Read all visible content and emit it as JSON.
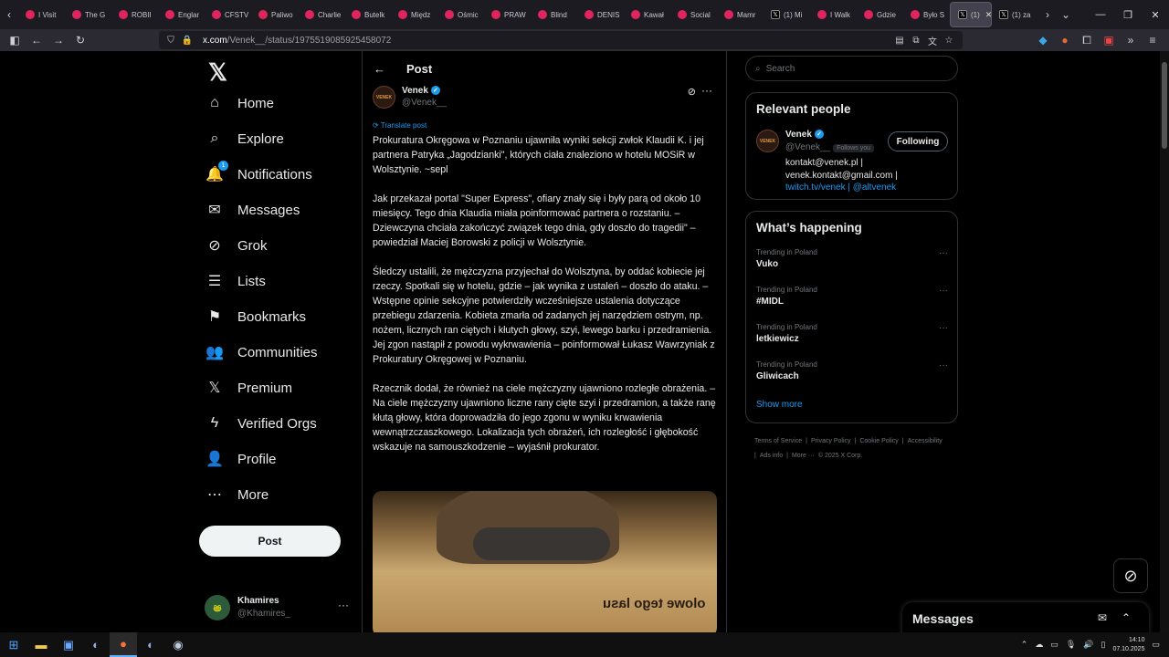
{
  "browser": {
    "tabs": [
      {
        "label": "I Visit",
        "icon": "yt-favicon"
      },
      {
        "label": "The G",
        "icon": "yt-favicon"
      },
      {
        "label": "ROBII",
        "icon": "yt-favicon"
      },
      {
        "label": "Englar",
        "icon": "yt-favicon"
      },
      {
        "label": "CFSTV",
        "icon": "yt-favicon"
      },
      {
        "label": "Paliwo",
        "icon": "yt-favicon"
      },
      {
        "label": "Charlie",
        "icon": "yt-favicon"
      },
      {
        "label": "Butelk",
        "icon": "yt-favicon"
      },
      {
        "label": "Międz",
        "icon": "yt-favicon"
      },
      {
        "label": "Ośmic",
        "icon": "yt-favicon"
      },
      {
        "label": "PRAW",
        "icon": "yt-favicon"
      },
      {
        "label": "Blind",
        "icon": "yt-favicon"
      },
      {
        "label": "DENIS",
        "icon": "yt-favicon"
      },
      {
        "label": "Kawał",
        "icon": "yt-favicon"
      },
      {
        "label": "Social",
        "icon": "yt-favicon"
      },
      {
        "label": "Mamr",
        "icon": "yt-favicon"
      },
      {
        "label": "(1) Mi",
        "icon": "x-favicon"
      },
      {
        "label": "I Walk",
        "icon": "yt-favicon"
      },
      {
        "label": "Gdzie",
        "icon": "yt-favicon"
      },
      {
        "label": "Było S",
        "icon": "yt-favicon"
      }
    ],
    "active_tab": {
      "label": "(1)",
      "icon": "x-favicon"
    },
    "after_tab": {
      "label": "(1) za",
      "icon": "x-favicon"
    },
    "url_domain": "x.com",
    "url_path": "/Venek__/status/1975519085925458072"
  },
  "nav": {
    "items": [
      {
        "label": "Home",
        "icon": "home-icon",
        "glyph": "⌂"
      },
      {
        "label": "Explore",
        "icon": "search-icon",
        "glyph": "⌕"
      },
      {
        "label": "Notifications",
        "icon": "bell-icon",
        "glyph": "🔔"
      },
      {
        "label": "Messages",
        "icon": "mail-icon",
        "glyph": "✉"
      },
      {
        "label": "Grok",
        "icon": "grok-icon",
        "glyph": "⊘"
      },
      {
        "label": "Lists",
        "icon": "list-icon",
        "glyph": "☰"
      },
      {
        "label": "Bookmarks",
        "icon": "bookmark-icon",
        "glyph": "⚑"
      },
      {
        "label": "Communities",
        "icon": "communities-icon",
        "glyph": "👥"
      },
      {
        "label": "Premium",
        "icon": "x-premium-icon",
        "glyph": "𝕏"
      },
      {
        "label": "Verified Orgs",
        "icon": "lightning-icon",
        "glyph": "ϟ"
      },
      {
        "label": "Profile",
        "icon": "person-icon",
        "glyph": "👤"
      },
      {
        "label": "More",
        "icon": "more-circle-icon",
        "glyph": "⋯"
      }
    ],
    "notif_count": "1",
    "post_label": "Post",
    "account_name": "Khamires",
    "account_handle": "@Khamires_"
  },
  "post": {
    "heading": "Post",
    "author_name": "Venek",
    "author_handle": "@Venek__",
    "avatar_text": "VENEK",
    "translate_label": "Translate post",
    "paragraphs": [
      "Prokuratura Okręgowa w Poznaniu ujawniła wyniki sekcji zwłok Klaudii K. i jej partnera Patryka „Jagodzianki\", których ciała znaleziono w hotelu MOSiR w Wolsztynie. ~sepl",
      "Jak przekazał portal \"Super Express\", ofiary znały się i były parą od około 10 miesięcy. Tego dnia Klaudia miała poinformować partnera o rozstaniu. – Dziewczyna chciała zakończyć związek tego dnia, gdy doszło do tragedii\" – powiedział Maciej Borowski z policji w Wolsztynie.",
      "Śledczy ustalili, że mężczyzna przyjechał do Wolsztyna, by oddać kobiecie jej rzeczy. Spotkali się w hotelu, gdzie – jak wynika z ustaleń – doszło do ataku. – Wstępne opinie sekcyjne potwierdziły wcześniejsze ustalenia dotyczące przebiegu zdarzenia. Kobieta zmarła od zadanych jej narzędziem ostrym, np. nożem, licznych ran ciętych i kłutych głowy, szyi, lewego barku i przedramienia. Jej zgon nastąpił z powodu wykrwawienia – poinformował Łukasz Wawrzyniak z Prokuratury Okręgowej w Poznaniu.",
      "Rzecznik dodał, że również na ciele mężczyzny ujawniono rozległe obrażenia. – Na ciele mężczyzny ujawniono liczne rany cięte szyi i przedramion, a także ranę kłutą głowy, która doprowadziła do jego zgonu w wyniku krwawienia wewnątrzczaszkowego. Lokalizacja tych obrażeń, ich rozległość i głębokość wskazuje na samouszkodzenie – wyjaśnił prokurator."
    ],
    "image_sign": "olowe tego lasu"
  },
  "sidebar": {
    "search_placeholder": "Search",
    "relevant_title": "Relevant people",
    "rp_name": "Venek",
    "rp_handle": "@Venek__",
    "rp_follows": "Follows you",
    "rp_following": "Following",
    "rp_bio_plain": "kontakt@venek.pl | venek.kontakt@gmail.com | ",
    "rp_bio_link1": "twitch.tv/venek",
    "rp_bio_sep": " | ",
    "rp_bio_link2": "@altvenek",
    "happening_title": "What’s happening",
    "trends": [
      {
        "category": "Trending in Poland",
        "name": "Vuko"
      },
      {
        "category": "Trending in Poland",
        "name": "#MIDL"
      },
      {
        "category": "Trending in Poland",
        "name": "letkiewicz"
      },
      {
        "category": "Trending in Poland",
        "name": "Gliwicach"
      }
    ],
    "show_more": "Show more",
    "footer": [
      "Terms of Service",
      "|",
      "Privacy Policy",
      "|",
      "Cookie Policy",
      "|",
      "Accessibility",
      "|",
      "Ads info",
      "|",
      "More ···",
      "© 2025 X Corp."
    ]
  },
  "dock": {
    "messages_title": "Messages"
  },
  "taskbar": {
    "time": "14:10",
    "date": "07.10.2025"
  },
  "colors": {
    "accent": "#1d9bf0",
    "bg": "#000000",
    "border": "#2f3336",
    "muted": "#71767b"
  }
}
